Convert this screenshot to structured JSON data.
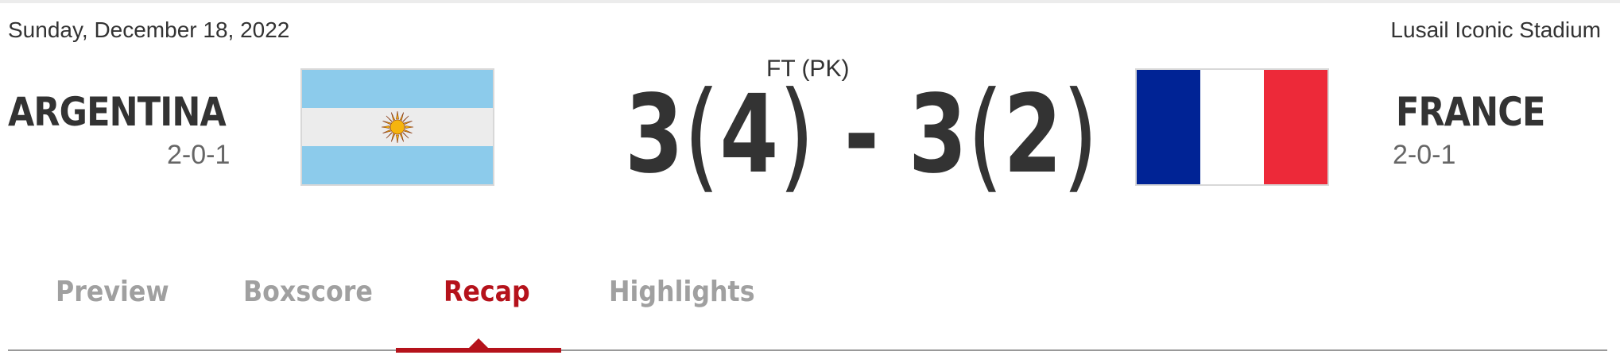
{
  "match": {
    "date": "Sunday, December 18, 2022",
    "venue": "Lusail Iconic Stadium",
    "status": "FT (PK)",
    "home": {
      "name": "ARGENTINA",
      "record": "2-0-1",
      "flag_icon": "argentina-flag-icon",
      "score": "3",
      "penalties": "4",
      "flag_colors": {
        "sky": "#8ccbeb",
        "white": "#ececec",
        "sun": "#f6b40e"
      }
    },
    "away": {
      "name": "FRANCE",
      "record": "2-0-1",
      "flag_icon": "france-flag-icon",
      "score": "3",
      "penalties": "2",
      "flag_colors": {
        "blue": "#002395",
        "white": "#ffffff",
        "red": "#ed2939"
      }
    },
    "separator": "-",
    "paren_open": "(",
    "paren_close": ")"
  },
  "tabs": [
    {
      "label": "Preview",
      "active": false
    },
    {
      "label": "Boxscore",
      "active": false
    },
    {
      "label": "Recap",
      "active": true
    },
    {
      "label": "Highlights",
      "active": false
    }
  ],
  "theme": {
    "accent": "#b5121b",
    "text": "#333333",
    "muted": "#a0a0a0"
  }
}
